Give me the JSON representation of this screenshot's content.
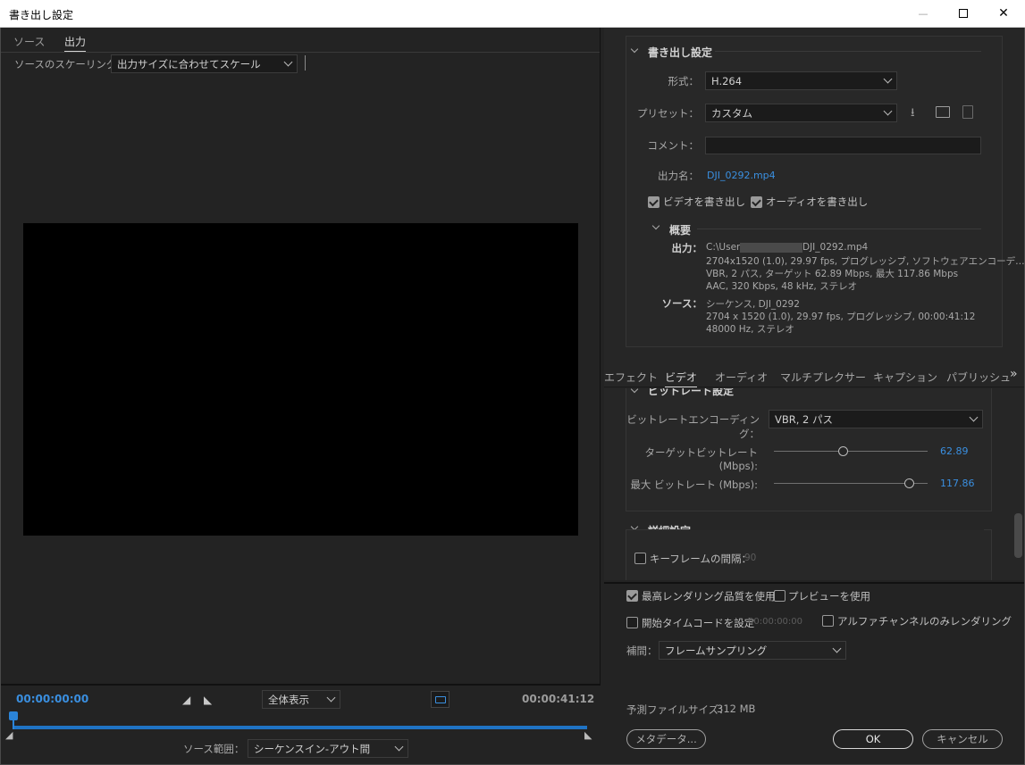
{
  "window": {
    "title": "書き出し設定",
    "minimize": "—",
    "maximize": "☐",
    "close": "✕"
  },
  "source_tabs": [
    {
      "label": "ソース"
    },
    {
      "label": "出力"
    }
  ],
  "scaling": {
    "label": "ソースのスケーリング：",
    "value": "出力サイズに合わせてスケール"
  },
  "timeline": {
    "in_time": "00:00:00:00",
    "out_time": "00:00:41:12",
    "zoom": "全体表示",
    "range_label": "ソース範囲：",
    "range_value": "シーケンスイン-アウト間"
  },
  "export_settings": {
    "title": "書き出し設定",
    "format_label": "形式：",
    "format_value": "H.264",
    "preset_label": "プリセット：",
    "preset_value": "カスタム",
    "comment_label": "コメント：",
    "comment_value": "",
    "output_name_label": "出力名：",
    "output_name_value": "DJI_0292.mp4",
    "export_video_label": "ビデオを書き出し",
    "export_audio_label": "オーディオを書き出し"
  },
  "summary": {
    "title": "概要",
    "output_label": "出力：",
    "output_path_prefix": "C:\\Users\\",
    "output_path_suffix": "DJI_0292.mp4",
    "output_line2": "2704x1520 (1.0), 29.97 fps, プログレッシブ, ソフトウェアエンコーデ…",
    "output_line3": "VBR, 2 パス, ターゲット 62.89 Mbps, 最大 117.86 Mbps",
    "output_line4": "AAC, 320 Kbps, 48 kHz, ステレオ",
    "source_label": "ソース：",
    "source_line1": "シーケンス, DJI_0292",
    "source_line2": "2704 x 1520 (1.0), 29.97 fps, プログレッシブ, 00:00:41:12",
    "source_line3": "48000 Hz, ステレオ"
  },
  "settings_tabs": [
    {
      "label": "エフェクト"
    },
    {
      "label": "ビデオ"
    },
    {
      "label": "オーディオ"
    },
    {
      "label": "マルチプレクサー"
    },
    {
      "label": "キャプション"
    },
    {
      "label": "パブリッシュ"
    }
  ],
  "bitrate": {
    "section_title": "ビットレート設定",
    "encoding_label": "ビットレートエンコーディング：",
    "encoding_value": "VBR, 2 パス",
    "target_label": "ターゲットビットレート (Mbps):",
    "target_value": "62.89",
    "target_fraction": 0.45,
    "max_label": "最大 ビットレート (Mbps):",
    "max_value": "117.86",
    "max_fraction": 0.88
  },
  "advanced": {
    "section_title": "詳細設定",
    "keyframe_label": "キーフレームの間隔：",
    "keyframe_value": "90"
  },
  "bottom": {
    "max_quality_label": "最高レンダリング品質を使用",
    "use_preview_label": "プレビューを使用",
    "start_timecode_label": "開始タイムコードを設定",
    "start_timecode_value": "00:00:00:00",
    "alpha_label": "アルファチャンネルのみレンダリング",
    "interp_label": "補間：",
    "interp_value": "フレームサンプリング",
    "filesize_label": "予測ファイルサイズ：",
    "filesize_value": "312 MB",
    "metadata_button": "メタデータ...",
    "ok_button": "OK",
    "cancel_button": "キャンセル"
  },
  "colors": {
    "accent": "#3a8fe0",
    "panel": "#262626",
    "background": "#232323"
  }
}
